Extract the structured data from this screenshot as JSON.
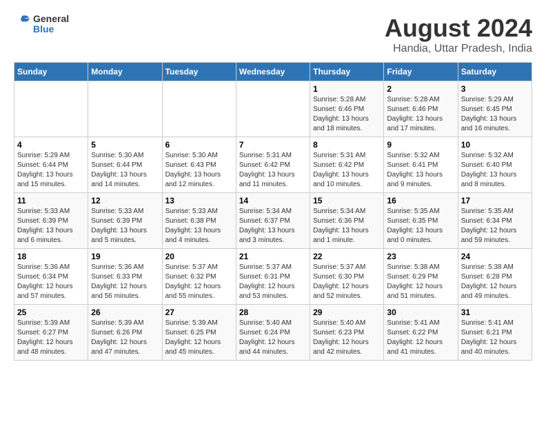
{
  "logo": {
    "line1": "General",
    "line2": "Blue"
  },
  "title": "August 2024",
  "subtitle": "Handia, Uttar Pradesh, India",
  "days_of_week": [
    "Sunday",
    "Monday",
    "Tuesday",
    "Wednesday",
    "Thursday",
    "Friday",
    "Saturday"
  ],
  "weeks": [
    [
      {
        "day": "",
        "info": ""
      },
      {
        "day": "",
        "info": ""
      },
      {
        "day": "",
        "info": ""
      },
      {
        "day": "",
        "info": ""
      },
      {
        "day": "1",
        "info": "Sunrise: 5:28 AM\nSunset: 6:46 PM\nDaylight: 13 hours\nand 18 minutes."
      },
      {
        "day": "2",
        "info": "Sunrise: 5:28 AM\nSunset: 6:46 PM\nDaylight: 13 hours\nand 17 minutes."
      },
      {
        "day": "3",
        "info": "Sunrise: 5:29 AM\nSunset: 6:45 PM\nDaylight: 13 hours\nand 16 minutes."
      }
    ],
    [
      {
        "day": "4",
        "info": "Sunrise: 5:29 AM\nSunset: 6:44 PM\nDaylight: 13 hours\nand 15 minutes."
      },
      {
        "day": "5",
        "info": "Sunrise: 5:30 AM\nSunset: 6:44 PM\nDaylight: 13 hours\nand 14 minutes."
      },
      {
        "day": "6",
        "info": "Sunrise: 5:30 AM\nSunset: 6:43 PM\nDaylight: 13 hours\nand 12 minutes."
      },
      {
        "day": "7",
        "info": "Sunrise: 5:31 AM\nSunset: 6:42 PM\nDaylight: 13 hours\nand 11 minutes."
      },
      {
        "day": "8",
        "info": "Sunrise: 5:31 AM\nSunset: 6:42 PM\nDaylight: 13 hours\nand 10 minutes."
      },
      {
        "day": "9",
        "info": "Sunrise: 5:32 AM\nSunset: 6:41 PM\nDaylight: 13 hours\nand 9 minutes."
      },
      {
        "day": "10",
        "info": "Sunrise: 5:32 AM\nSunset: 6:40 PM\nDaylight: 13 hours\nand 8 minutes."
      }
    ],
    [
      {
        "day": "11",
        "info": "Sunrise: 5:33 AM\nSunset: 6:39 PM\nDaylight: 13 hours\nand 6 minutes."
      },
      {
        "day": "12",
        "info": "Sunrise: 5:33 AM\nSunset: 6:39 PM\nDaylight: 13 hours\nand 5 minutes."
      },
      {
        "day": "13",
        "info": "Sunrise: 5:33 AM\nSunset: 6:38 PM\nDaylight: 13 hours\nand 4 minutes."
      },
      {
        "day": "14",
        "info": "Sunrise: 5:34 AM\nSunset: 6:37 PM\nDaylight: 13 hours\nand 3 minutes."
      },
      {
        "day": "15",
        "info": "Sunrise: 5:34 AM\nSunset: 6:36 PM\nDaylight: 13 hours\nand 1 minute."
      },
      {
        "day": "16",
        "info": "Sunrise: 5:35 AM\nSunset: 6:35 PM\nDaylight: 13 hours\nand 0 minutes."
      },
      {
        "day": "17",
        "info": "Sunrise: 5:35 AM\nSunset: 6:34 PM\nDaylight: 12 hours\nand 59 minutes."
      }
    ],
    [
      {
        "day": "18",
        "info": "Sunrise: 5:36 AM\nSunset: 6:34 PM\nDaylight: 12 hours\nand 57 minutes."
      },
      {
        "day": "19",
        "info": "Sunrise: 5:36 AM\nSunset: 6:33 PM\nDaylight: 12 hours\nand 56 minutes."
      },
      {
        "day": "20",
        "info": "Sunrise: 5:37 AM\nSunset: 6:32 PM\nDaylight: 12 hours\nand 55 minutes."
      },
      {
        "day": "21",
        "info": "Sunrise: 5:37 AM\nSunset: 6:31 PM\nDaylight: 12 hours\nand 53 minutes."
      },
      {
        "day": "22",
        "info": "Sunrise: 5:37 AM\nSunset: 6:30 PM\nDaylight: 12 hours\nand 52 minutes."
      },
      {
        "day": "23",
        "info": "Sunrise: 5:38 AM\nSunset: 6:29 PM\nDaylight: 12 hours\nand 51 minutes."
      },
      {
        "day": "24",
        "info": "Sunrise: 5:38 AM\nSunset: 6:28 PM\nDaylight: 12 hours\nand 49 minutes."
      }
    ],
    [
      {
        "day": "25",
        "info": "Sunrise: 5:39 AM\nSunset: 6:27 PM\nDaylight: 12 hours\nand 48 minutes."
      },
      {
        "day": "26",
        "info": "Sunrise: 5:39 AM\nSunset: 6:26 PM\nDaylight: 12 hours\nand 47 minutes."
      },
      {
        "day": "27",
        "info": "Sunrise: 5:39 AM\nSunset: 6:25 PM\nDaylight: 12 hours\nand 45 minutes."
      },
      {
        "day": "28",
        "info": "Sunrise: 5:40 AM\nSunset: 6:24 PM\nDaylight: 12 hours\nand 44 minutes."
      },
      {
        "day": "29",
        "info": "Sunrise: 5:40 AM\nSunset: 6:23 PM\nDaylight: 12 hours\nand 42 minutes."
      },
      {
        "day": "30",
        "info": "Sunrise: 5:41 AM\nSunset: 6:22 PM\nDaylight: 12 hours\nand 41 minutes."
      },
      {
        "day": "31",
        "info": "Sunrise: 5:41 AM\nSunset: 6:21 PM\nDaylight: 12 hours\nand 40 minutes."
      }
    ]
  ],
  "colors": {
    "header_bg": "#2e74b5",
    "header_text": "#ffffff",
    "accent_blue": "#2e74b5"
  }
}
